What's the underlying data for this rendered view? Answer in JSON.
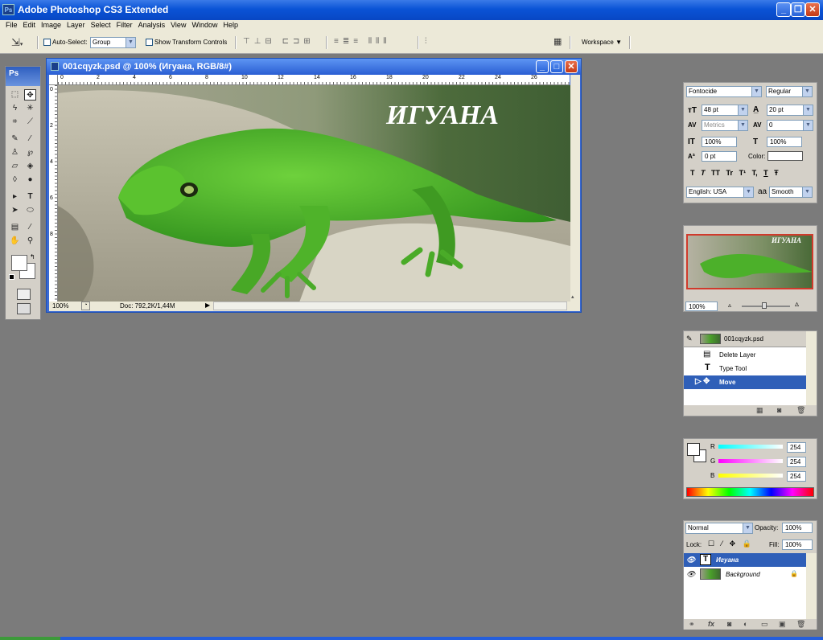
{
  "app": {
    "title": "Adobe Photoshop CS3 Extended",
    "logo": "Ps"
  },
  "menu": [
    "File",
    "Edit",
    "Image",
    "Layer",
    "Select",
    "Filter",
    "Analysis",
    "View",
    "Window",
    "Help"
  ],
  "options": {
    "auto_select_label": "Auto-Select:",
    "auto_select_value": "Group",
    "show_transform_label": "Show Transform Controls",
    "workspace_label": "Workspace"
  },
  "toolbox": {
    "header": "Ps"
  },
  "document": {
    "title": "001cqyzk.psd @ 100% (Игуана, RGB/8#)",
    "zoom": "100%",
    "doc_info": "Doc: 792,2K/1,44M",
    "canvas_text": "ИГУАНА",
    "ruler_h": [
      "0",
      "2",
      "4",
      "6",
      "8",
      "10",
      "12",
      "14",
      "16",
      "18",
      "20",
      "22",
      "24",
      "26"
    ],
    "ruler_v": [
      "0",
      "2",
      "4",
      "6",
      "8"
    ]
  },
  "character": {
    "font": "Fontocide",
    "style": "Regular",
    "size": "48 pt",
    "leading": "20 pt",
    "kerning": "Metrics",
    "tracking": "0",
    "vscale": "100%",
    "hscale": "100%",
    "baseline": "0 pt",
    "color_label": "Color:",
    "language": "English: USA",
    "antialias_icon": "aa",
    "antialias": "Smooth",
    "type_buttons": [
      "T",
      "T",
      "TT",
      "Tr",
      "T¹",
      "T,",
      "T",
      "Ŧ"
    ]
  },
  "navigator": {
    "zoom": "100%",
    "thumb_text": "ИГУАНА"
  },
  "history": {
    "snapshot": "001cqyzk.psd",
    "items": [
      "Delete Layer",
      "Type Tool",
      "Move"
    ]
  },
  "color": {
    "r_label": "R",
    "g_label": "G",
    "b_label": "B",
    "r": "254",
    "g": "254",
    "b": "254"
  },
  "layers": {
    "blend": "Normal",
    "opacity_label": "Opacity:",
    "opacity": "100%",
    "lock_label": "Lock:",
    "fill_label": "Fill:",
    "fill": "100%",
    "items": [
      {
        "name": "Игуана",
        "type": "text"
      },
      {
        "name": "Background",
        "type": "image"
      }
    ]
  }
}
